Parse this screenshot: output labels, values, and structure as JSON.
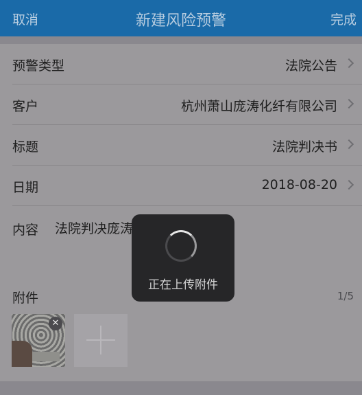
{
  "nav": {
    "cancel": "取消",
    "title": "新建风险预警",
    "done": "完成"
  },
  "form": {
    "rows": [
      {
        "label": "预警类型",
        "value": "法院公告"
      },
      {
        "label": "客户",
        "value": "杭州萧山庞涛化纤有限公司"
      },
      {
        "label": "标题",
        "value": "法院判决书"
      },
      {
        "label": "日期",
        "value": "2018-08-20"
      }
    ],
    "content_label": "内容",
    "content_value": "法院判决庞涛          500万"
  },
  "attachments": {
    "label": "附件",
    "count": "1/5"
  },
  "hud": {
    "message": "正在上传附件"
  },
  "icons": [
    "chevron-right-icon",
    "close-icon",
    "plus-icon",
    "spinner-icon"
  ]
}
